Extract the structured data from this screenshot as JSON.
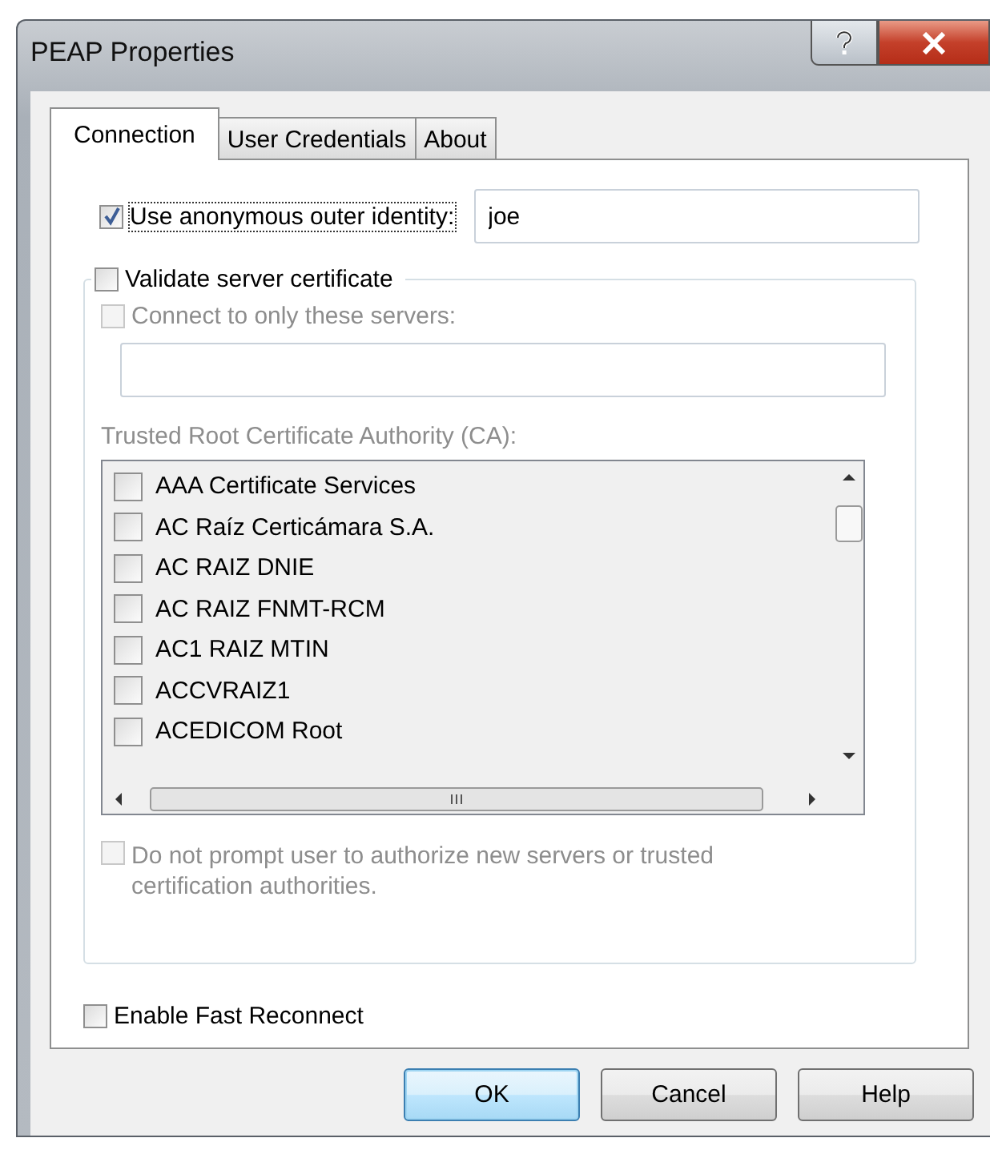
{
  "window": {
    "title": "PEAP Properties"
  },
  "tabs": [
    {
      "label": "Connection",
      "selected": true
    },
    {
      "label": "User Credentials",
      "selected": false
    },
    {
      "label": "About",
      "selected": false
    }
  ],
  "outer_identity": {
    "label": "Use anonymous outer identity:",
    "checked": true,
    "value": "joe"
  },
  "validate_certificate": {
    "label": "Validate server certificate",
    "checked": false
  },
  "connect_servers": {
    "label": "Connect to only these servers:",
    "checked": false,
    "disabled": true
  },
  "ca_list": {
    "label": "Trusted Root Certificate Authority (CA):",
    "disabled": true,
    "items": [
      {
        "name": "AAA Certificate Services",
        "checked": false
      },
      {
        "name": "AC Raíz Certicámara S.A.",
        "checked": false
      },
      {
        "name": "AC RAIZ DNIE",
        "checked": false
      },
      {
        "name": "AC RAIZ FNMT-RCM",
        "checked": false
      },
      {
        "name": "AC1 RAIZ MTIN",
        "checked": false
      },
      {
        "name": "ACCVRAIZ1",
        "checked": false
      },
      {
        "name": "ACEDICOM Root",
        "checked": false
      }
    ]
  },
  "no_prompt": {
    "label": "Do not prompt user to authorize new servers or trusted certification authorities.",
    "checked": false,
    "disabled": true
  },
  "fast_reconnect": {
    "label": "Enable Fast Reconnect",
    "checked": false
  },
  "buttons": [
    {
      "label": "OK",
      "default": true
    },
    {
      "label": "Cancel",
      "default": false
    },
    {
      "label": "Help",
      "default": false
    }
  ]
}
